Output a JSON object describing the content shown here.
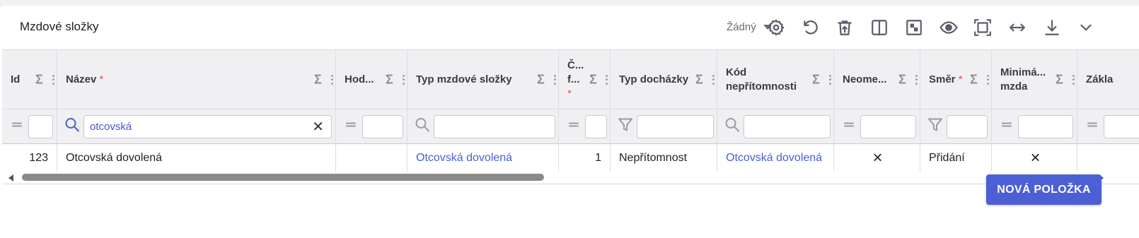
{
  "panel": {
    "title": "Mzdové složky",
    "view_select": "Žádný"
  },
  "toolbar": {
    "icons": [
      "settings-icon",
      "reset-icon",
      "delete-filter-icon",
      "columns-icon",
      "layout-icon",
      "visibility-icon",
      "fit-screen-icon",
      "resize-width-icon",
      "download-icon",
      "collapse-icon"
    ]
  },
  "grid": {
    "columns": [
      {
        "label": "Id",
        "required": false
      },
      {
        "label": "Název",
        "required": true
      },
      {
        "label": "Hod...",
        "required": false
      },
      {
        "label": "Typ mzdové složky",
        "required": false
      },
      {
        "label": "Č... f...",
        "required": true
      },
      {
        "label": "Typ docházky",
        "required": false
      },
      {
        "label": "Kód nepřítomnosti",
        "required": false
      },
      {
        "label": "Neome...",
        "required": false
      },
      {
        "label": "Směr",
        "required": true
      },
      {
        "label": "Minimá... mzda",
        "required": false
      },
      {
        "label": "Zákla",
        "required": false
      }
    ],
    "required_mark": "*",
    "sigma": "Σ",
    "filters": {
      "nazev_value": "otcovská",
      "clear": "✕"
    },
    "row": {
      "id": "123",
      "nazev": "Otcovská dovolená",
      "hod": "",
      "typ_mzdove_slozky": "Otcovská dovolená",
      "cislo": "1",
      "typ_dochazky": "Nepřítomnost",
      "kod_nepritomnosti": "Otcovská dovolená",
      "neomezene": "✕",
      "smer": "Přidání",
      "minimalni_mzda": "✕"
    }
  },
  "footer": {
    "new_item_label": "NOVÁ POLOŽKA"
  },
  "colors": {
    "accent": "#4c5fd5",
    "link": "#4b5fd1",
    "required": "#e05353"
  }
}
